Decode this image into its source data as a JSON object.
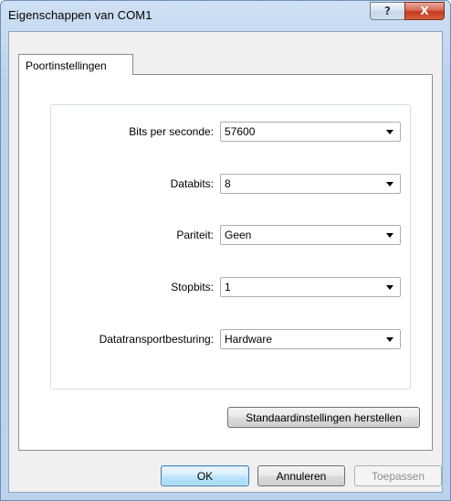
{
  "window": {
    "title": "Eigenschappen van COM1",
    "help_glyph": "?",
    "close_glyph": "X"
  },
  "tabs": [
    {
      "label": "Poortinstellingen",
      "selected": true
    }
  ],
  "settings": [
    {
      "label": "Bits per seconde:",
      "value": "57600"
    },
    {
      "label": "Databits:",
      "value": "8"
    },
    {
      "label": "Pariteit:",
      "value": "Geen"
    },
    {
      "label": "Stopbits:",
      "value": "1"
    },
    {
      "label": "Datatransportbesturing:",
      "value": "Hardware"
    }
  ],
  "buttons": {
    "restore_defaults": "Standaardinstellingen herstellen",
    "ok": "OK",
    "cancel": "Annuleren",
    "apply": "Toepassen"
  },
  "colors": {
    "title_bar": "#bcd3ee",
    "close_button": "#c4391c",
    "default_button_border": "#3c7fb1"
  }
}
